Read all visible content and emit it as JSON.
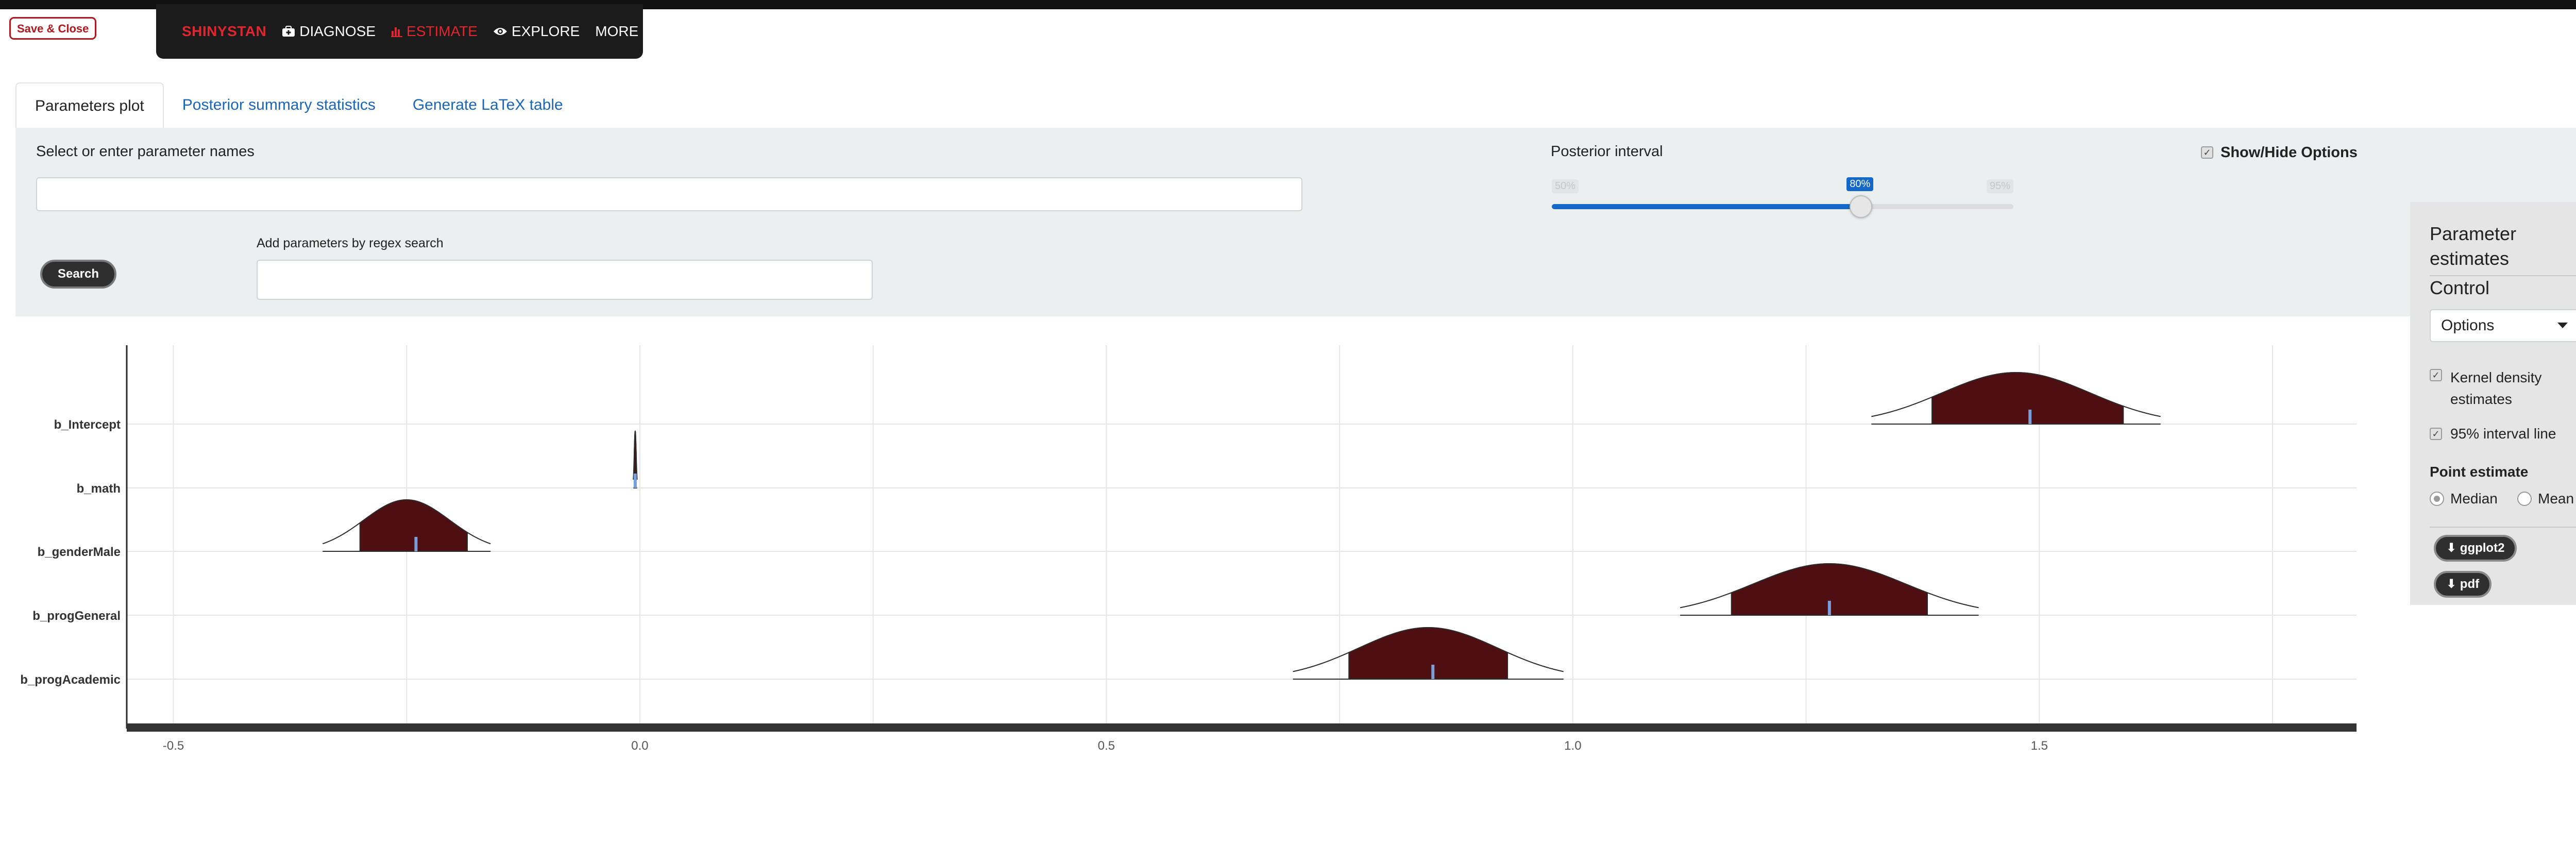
{
  "topbar": {
    "save_close": "Save & Close"
  },
  "navbar": {
    "brand": "SHINYSTAN",
    "items": [
      {
        "label": "DIAGNOSE",
        "icon": "medkit-icon"
      },
      {
        "label": "ESTIMATE",
        "icon": "bar-chart-icon",
        "active": true
      },
      {
        "label": "EXPLORE",
        "icon": "eye-icon"
      },
      {
        "label": "MORE",
        "icon": "caret-down-icon"
      }
    ],
    "accent": "#e0262f"
  },
  "tabs": [
    {
      "label": "Parameters plot",
      "active": true
    },
    {
      "label": "Posterior summary statistics"
    },
    {
      "label": "Generate LaTeX table"
    }
  ],
  "controls": {
    "param_label": "Select or enter parameter names",
    "param_value": "",
    "regex_label": "Add parameters by regex search",
    "regex_value": "",
    "search_label": "Search",
    "interval_label": "Posterior interval",
    "interval_min": "50%",
    "interval_value": "80%",
    "interval_max": "95%",
    "interval_fraction": 0.67,
    "show_hide_label": "Show/Hide Options",
    "show_hide_checked": true
  },
  "sidebar": {
    "title": "Parameter estimates",
    "control_title": "Control",
    "dropdown_value": "Options",
    "kde_label": "Kernel density estimates",
    "kde_checked": true,
    "interval_line_label": "95% interval line",
    "interval_line_checked": true,
    "point_estimate_title": "Point estimate",
    "median_label": "Median",
    "mean_label": "Mean",
    "selected": "Median",
    "ggplot_label": "ggplot2",
    "pdf_label": "pdf"
  },
  "chart_data": {
    "type": "ridgeline",
    "xlim": [
      -0.55,
      1.84
    ],
    "xticks": [
      -0.5,
      0.0,
      0.5,
      1.0,
      1.5
    ],
    "xtick_labels": [
      "-0.5",
      "0.0",
      "0.5",
      "1.0",
      "1.5"
    ],
    "grid": true,
    "colors": {
      "fill": "#4e0f12",
      "median": "#7a9fd8",
      "line": "#2b2b2b"
    },
    "parameters": [
      {
        "name": "b_Intercept",
        "median": 1.49,
        "inner": [
          1.385,
          1.59
        ],
        "outer": [
          1.32,
          1.63
        ],
        "peak": 1.0
      },
      {
        "name": "b_math",
        "median": -0.005,
        "inner": [
          -0.006,
          -0.004
        ],
        "outer": [
          -0.007,
          -0.003
        ],
        "peak": 1.0
      },
      {
        "name": "b_genderMale",
        "median": -0.24,
        "inner": [
          -0.3,
          -0.185
        ],
        "outer": [
          -0.34,
          -0.16
        ],
        "peak": 1.0
      },
      {
        "name": "b_progGeneral",
        "median": 1.275,
        "inner": [
          1.17,
          1.38
        ],
        "outer": [
          1.115,
          1.435
        ],
        "peak": 1.0
      },
      {
        "name": "b_progAcademic",
        "median": 0.85,
        "inner": [
          0.76,
          0.93
        ],
        "outer": [
          0.7,
          0.99
        ],
        "peak": 1.0
      }
    ]
  }
}
